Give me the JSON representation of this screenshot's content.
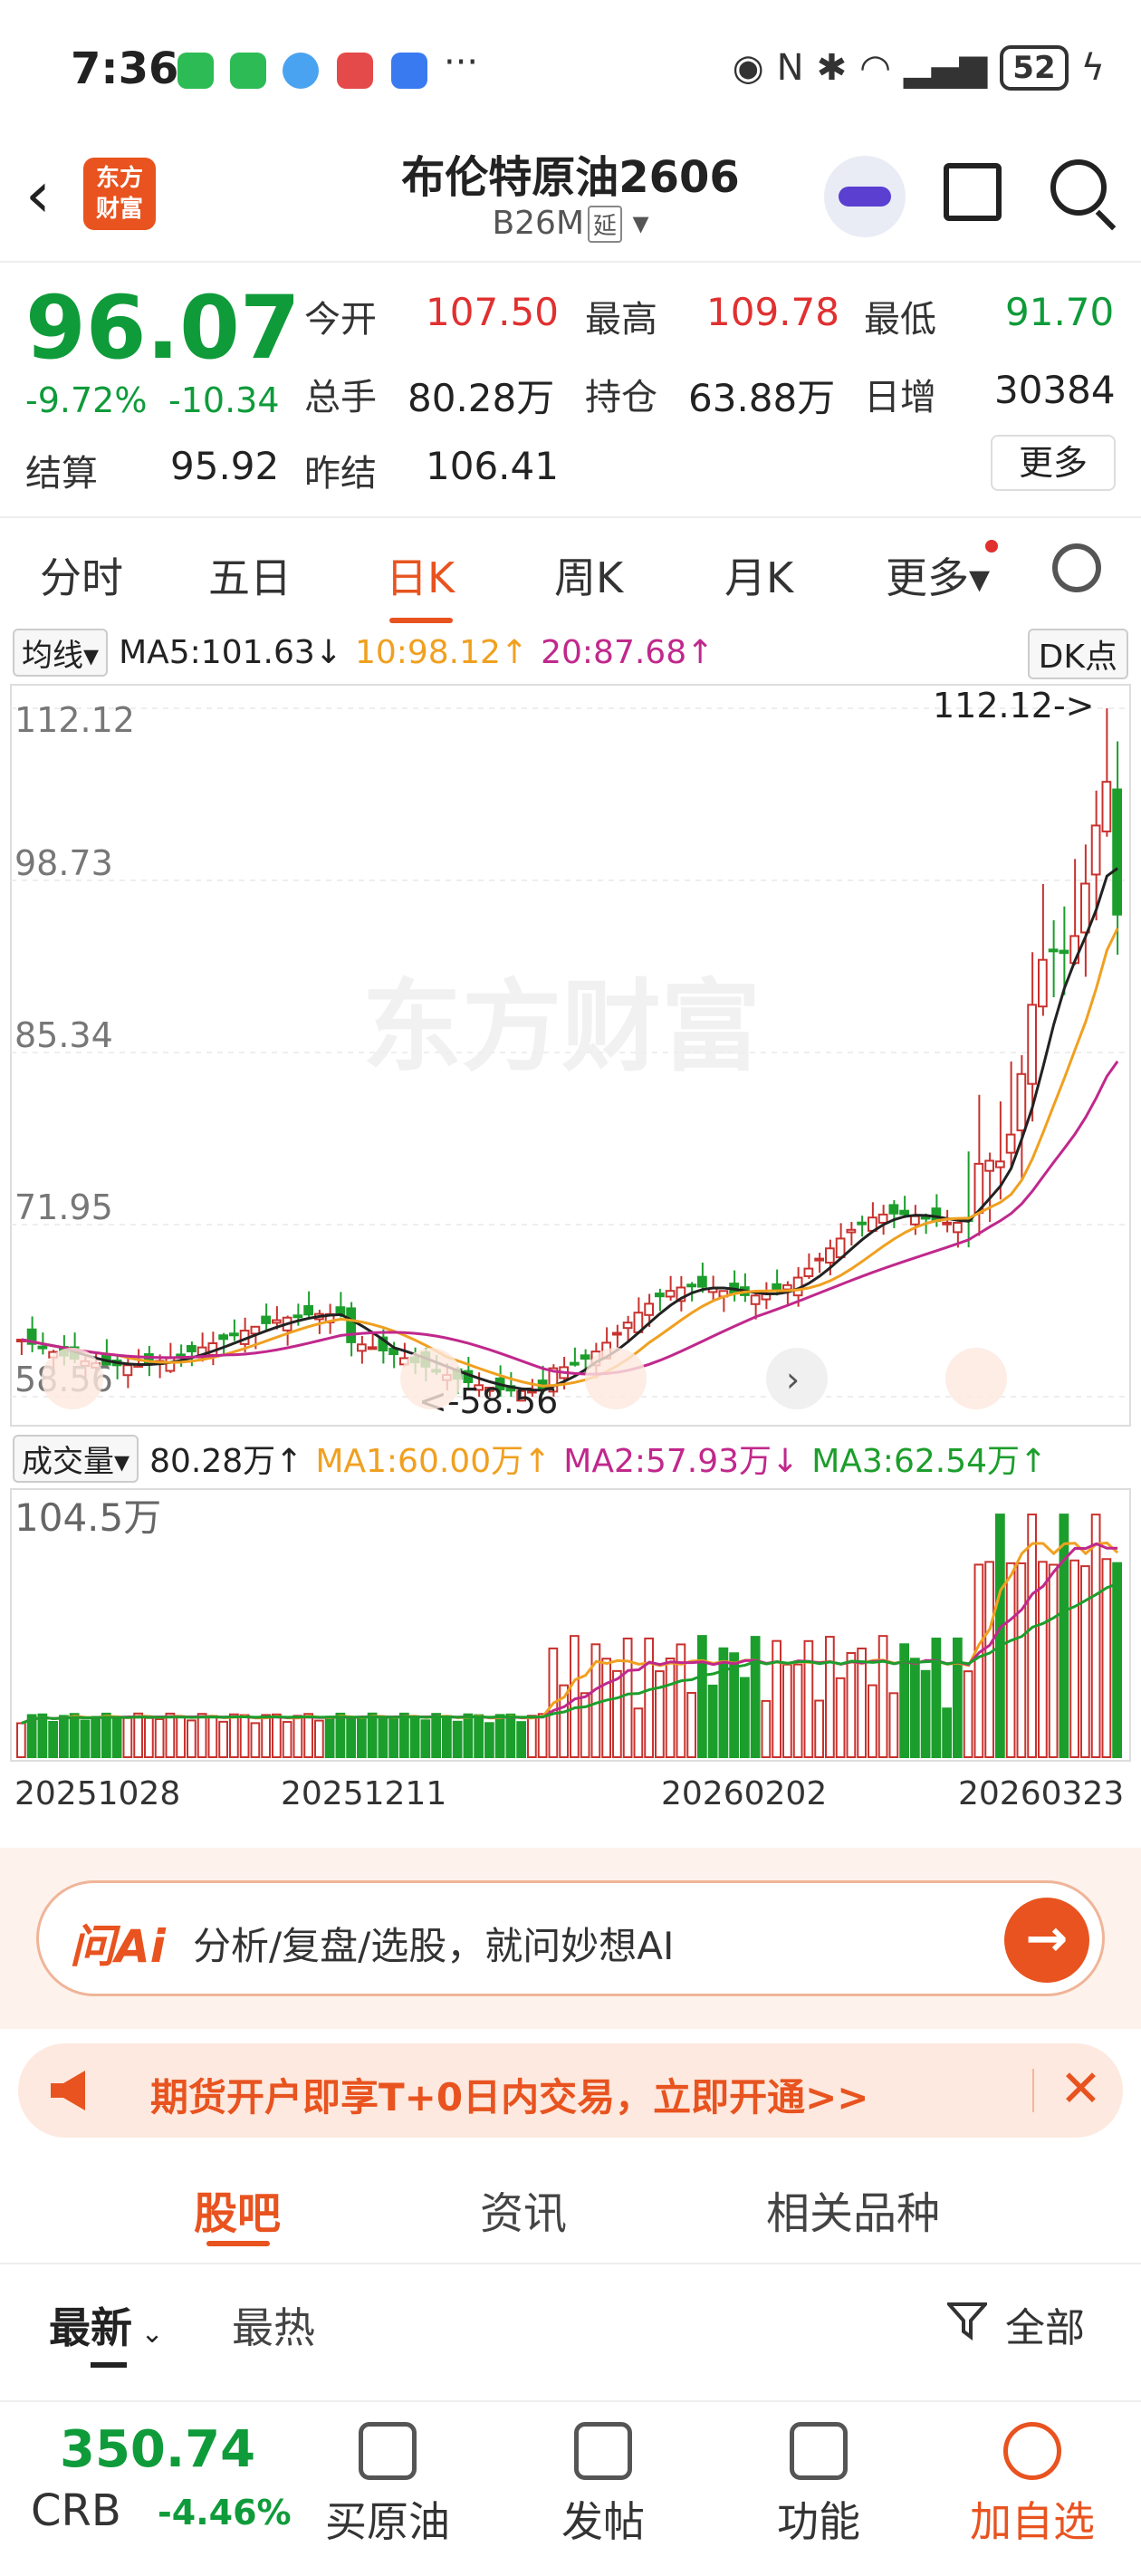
{
  "status": {
    "time": "7:36",
    "more": "···",
    "battery": "52"
  },
  "header": {
    "title": "布伦特原油2606",
    "code": "B26M",
    "tag": "延",
    "logo_line1": "东方",
    "logo_line2": "财富"
  },
  "quote": {
    "price": "96.07",
    "pct": "-9.72%",
    "chg": "-10.34",
    "labels": {
      "open": "今开",
      "high": "最高",
      "low": "最低",
      "vol": "总手",
      "oi": "持仓",
      "dayadd": "日增",
      "settle": "结算",
      "prevsettle": "昨结"
    },
    "values": {
      "open": "107.50",
      "high": "109.78",
      "low": "91.70",
      "vol": "80.28万",
      "oi": "63.88万",
      "dayadd": "30384",
      "settle": "95.92",
      "prevsettle": "106.41"
    },
    "more": "更多"
  },
  "ktabs": [
    "分时",
    "五日",
    "日K",
    "周K",
    "月K",
    "更多"
  ],
  "ma": {
    "pill": "均线",
    "ma5": "MA5:101.63↓",
    "ma10": "10:98.12↑",
    "ma20": "20:87.68↑",
    "dk": "DK点"
  },
  "chart_data": {
    "type": "candlestick",
    "yticks": [
      "112.12",
      "98.73",
      "85.34",
      "71.95",
      "58.56"
    ],
    "ylim": [
      58.56,
      112.12
    ],
    "max_label": "112.12->",
    "min_label": "<-58.56",
    "watermark": "东方财富",
    "xticks": [
      "20251028",
      "20251211",
      "20260202",
      "20260323"
    ],
    "colors": {
      "up": "#c8322e",
      "down": "#1c9e2c",
      "ma5": "#222222",
      "ma10": "#f0a020",
      "ma20": "#c0288c"
    }
  },
  "volume": {
    "pill": "成交量",
    "val": "80.28万↑",
    "ma1": "MA1:60.00万↑",
    "ma2": "MA2:57.93万↓",
    "ma3": "MA3:62.54万↑",
    "ymax": "104.5万"
  },
  "ai": {
    "logo": "问Ai",
    "text": "分析/复盘/选股，就问妙想AI",
    "go": "→"
  },
  "banner": {
    "text": "期货开户即享T+0日内交易，立即开通>>",
    "close": "✕"
  },
  "subtabs": [
    "股吧",
    "资讯",
    "相关品种"
  ],
  "filter": {
    "latest": "最新",
    "hot": "最热",
    "all": "全部"
  },
  "bottom": {
    "crb_value": "350.74",
    "crb_name": "CRB",
    "crb_pct": "-4.46%",
    "items": [
      "买原油",
      "发帖",
      "功能",
      "加自选"
    ]
  }
}
